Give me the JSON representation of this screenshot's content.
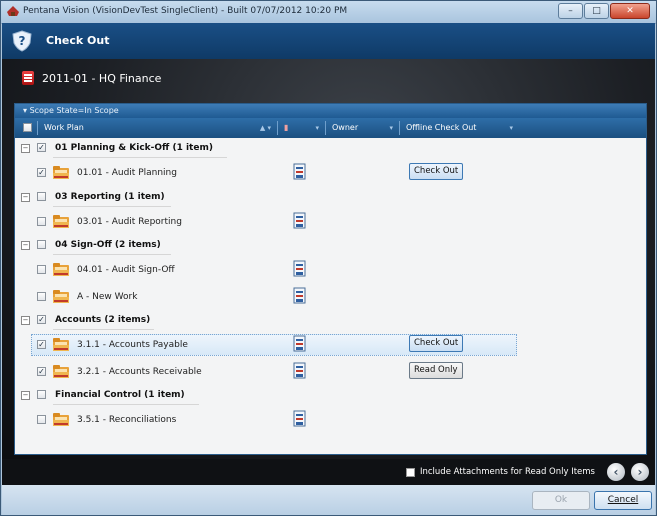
{
  "window": {
    "title": "Pentana Vision (VisionDevTest SingleClient) - Built 07/07/2012 10:20 PM",
    "controls": {
      "minimize": "–",
      "maximize": "□",
      "close": "✕"
    }
  },
  "header": {
    "title": "Check Out"
  },
  "project": {
    "name": "2011-01 - HQ Finance"
  },
  "grid": {
    "group_bar": "Scope State=In Scope",
    "columns": {
      "work_plan": "Work Plan",
      "owner": "Owner",
      "offline_check_out": "Offline Check Out"
    },
    "groups": [
      {
        "label": "01 Planning & Kick-Off (1 item)",
        "checked": true,
        "items": [
          {
            "label": "01.01 - Audit Planning",
            "checked": true,
            "action": "Check Out",
            "action_style": "blue"
          }
        ]
      },
      {
        "label": "03 Reporting (1 item)",
        "checked": false,
        "items": [
          {
            "label": "03.01 - Audit Reporting",
            "checked": false,
            "action": ""
          }
        ]
      },
      {
        "label": "04 Sign-Off (2 items)",
        "checked": false,
        "items": [
          {
            "label": "04.01 - Audit Sign-Off",
            "checked": false,
            "action": ""
          },
          {
            "label": "A - New Work",
            "checked": false,
            "action": ""
          }
        ]
      },
      {
        "label": "Accounts (2 items)",
        "checked": true,
        "items": [
          {
            "label": "3.1.1 - Accounts Payable",
            "checked": true,
            "action": "Check Out",
            "action_style": "blue",
            "selected": true
          },
          {
            "label": "3.2.1 - Accounts Receivable",
            "checked": true,
            "action": "Read Only",
            "action_style": "gray"
          }
        ]
      },
      {
        "label": "Financial Control (1 item)",
        "checked": false,
        "items": [
          {
            "label": "3.5.1 - Reconciliations",
            "checked": false,
            "action": ""
          }
        ]
      }
    ]
  },
  "footer": {
    "include_attachments": "Include Attachments for Read Only Items",
    "ok": "Ok",
    "cancel": "Cancel"
  }
}
